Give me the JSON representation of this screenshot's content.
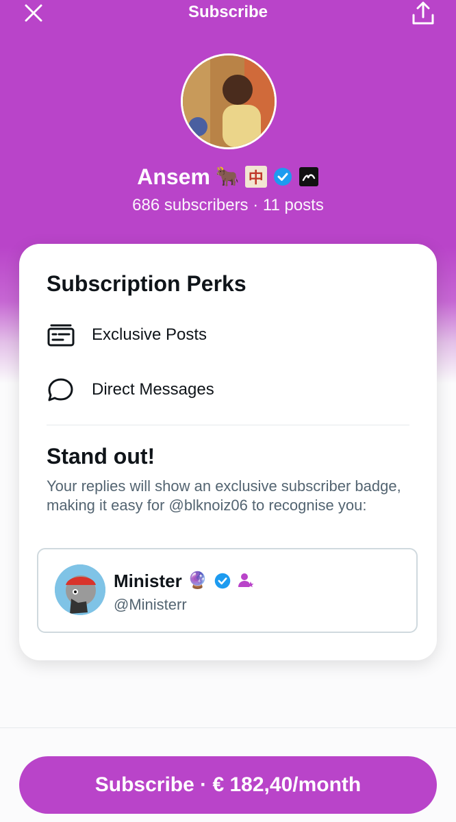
{
  "header": {
    "title": "Subscribe",
    "close_icon": "close-icon",
    "share_icon": "share-icon"
  },
  "profile": {
    "name": "Ansem",
    "emoji_1": "🐂",
    "badge_char": "中",
    "verified_icon": "verified-badge-icon",
    "affiliate_icon": "affiliate-badge-icon",
    "stats": "686 subscribers · 11 posts"
  },
  "perks": {
    "title": "Subscription Perks",
    "items": [
      {
        "label": "Exclusive Posts",
        "icon": "exclusive-posts-icon"
      },
      {
        "label": "Direct Messages",
        "icon": "message-bubble-icon"
      }
    ]
  },
  "standout": {
    "title": "Stand out!",
    "description": "Your replies will show an exclusive subscriber badge, making it easy for @blknoiz06 to recognise you:"
  },
  "preview": {
    "name": "Minister",
    "emoji": "🔮",
    "handle": "@Ministerr"
  },
  "footer": {
    "subscribe_label": "Subscribe · € 182,40/month"
  },
  "colors": {
    "accent": "#b944c9",
    "verified": "#1d9bf0",
    "text_primary": "#0f1419",
    "text_secondary": "#536471"
  }
}
